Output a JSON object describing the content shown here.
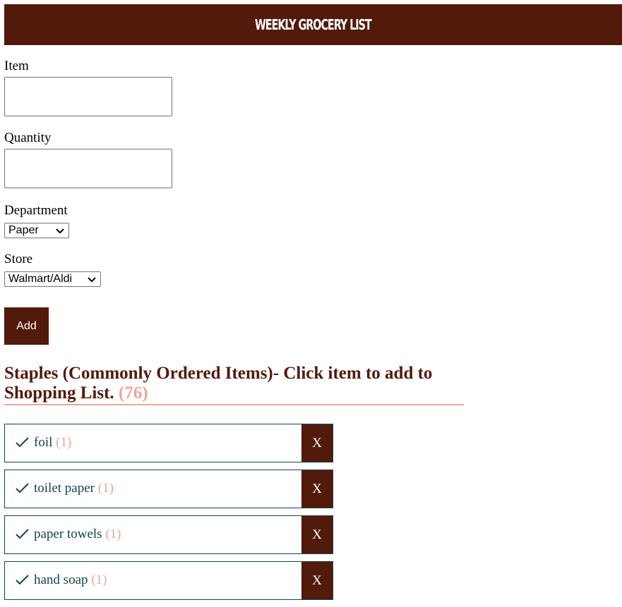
{
  "header": {
    "title": "WEEKLY GROCERY LIST"
  },
  "form": {
    "item_label": "Item",
    "item_value": "",
    "quantity_label": "Quantity",
    "quantity_value": "",
    "department_label": "Department",
    "department_selected": "Paper",
    "store_label": "Store",
    "store_selected": "Walmart/Aldi",
    "add_label": "Add"
  },
  "staples": {
    "heading": "Staples (Commonly Ordered Items)- Click item to add to Shopping List.",
    "count": "(76)",
    "items": [
      {
        "name": "foil",
        "qty": "(1)",
        "remove_label": "X"
      },
      {
        "name": "toilet paper",
        "qty": "(1)",
        "remove_label": "X"
      },
      {
        "name": "paper towels",
        "qty": "(1)",
        "remove_label": "X"
      },
      {
        "name": "hand soap",
        "qty": "(1)",
        "remove_label": "X"
      }
    ]
  },
  "colors": {
    "brand_dark": "#521a0b",
    "accent_pink": "#e8a898",
    "teal": "#12444a"
  },
  "icons": {
    "check": "check-icon",
    "chevron": "chevron-down-icon"
  }
}
